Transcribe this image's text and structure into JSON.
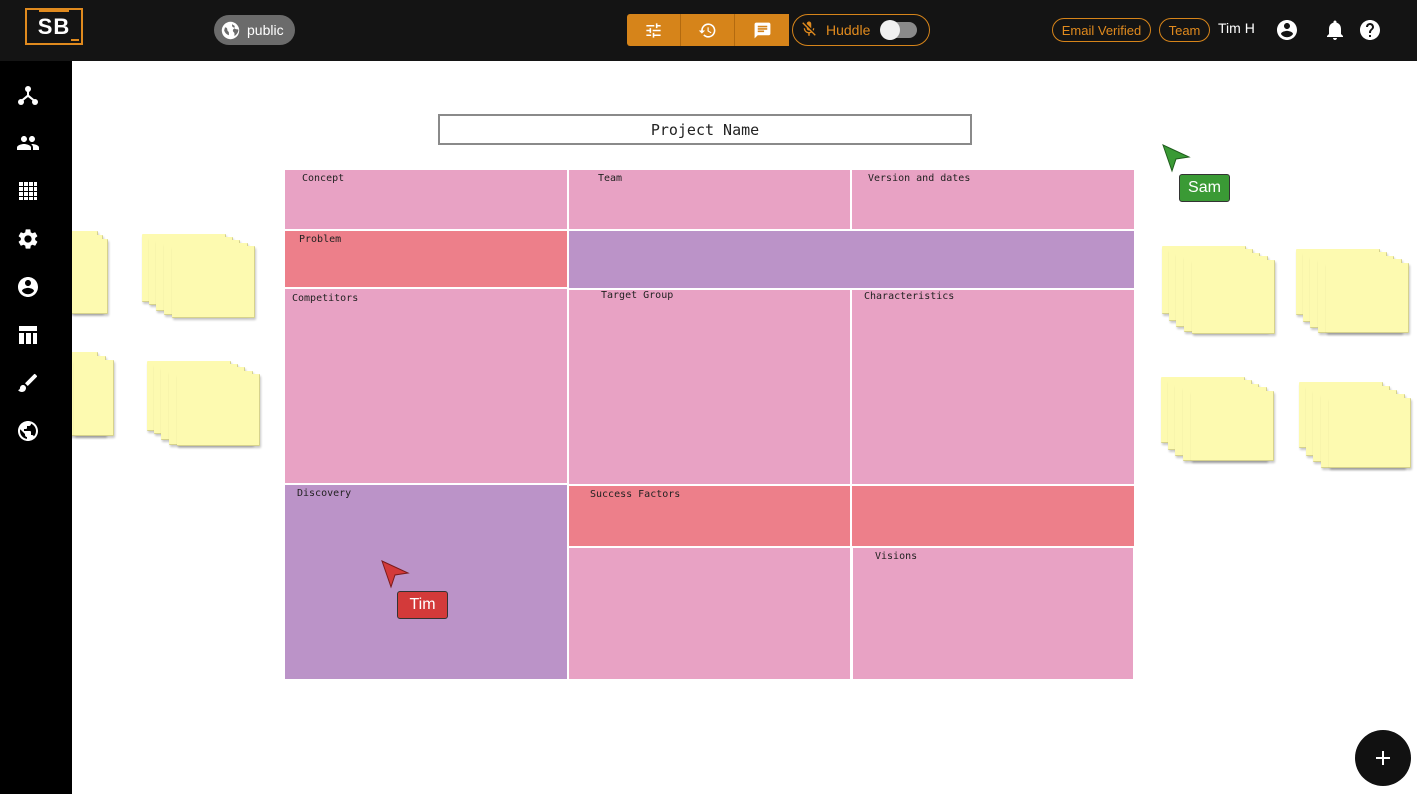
{
  "header": {
    "logo_text": "SB",
    "visibility_label": "public",
    "toolbar": {
      "icons": [
        "tune-icon",
        "history-icon",
        "chat-icon"
      ]
    },
    "huddle": {
      "label": "Huddle",
      "enabled": false
    },
    "badges": {
      "email_verified": "Email Verified",
      "team": "Team"
    },
    "user_name": "Tim H",
    "accent_color": "#d6841a"
  },
  "sidebar": {
    "icons": [
      "network-icon",
      "people-icon",
      "grid-icon",
      "settings-icon",
      "account-icon",
      "table-icon",
      "brush-icon",
      "globe-icon"
    ]
  },
  "board": {
    "project_name": "Project Name",
    "cells": {
      "concept": "Concept",
      "team": "Team",
      "version": "Version and dates",
      "problem": "Problem",
      "competitors": "Competitors",
      "target_group": "Target Group",
      "characteristics": "Characteristics",
      "discovery": "Discovery",
      "success_factors": "Success Factors",
      "visions": "Visions"
    },
    "colors": {
      "pink": "#e8a2c4",
      "red": "#ed7f8a",
      "purple": "#bb93c8",
      "sticky": "#fdfab0"
    }
  },
  "cursors": {
    "sam": {
      "name": "Sam",
      "color": "#3a9a35"
    },
    "tim": {
      "name": "Tim",
      "color": "#d33a3a"
    }
  }
}
